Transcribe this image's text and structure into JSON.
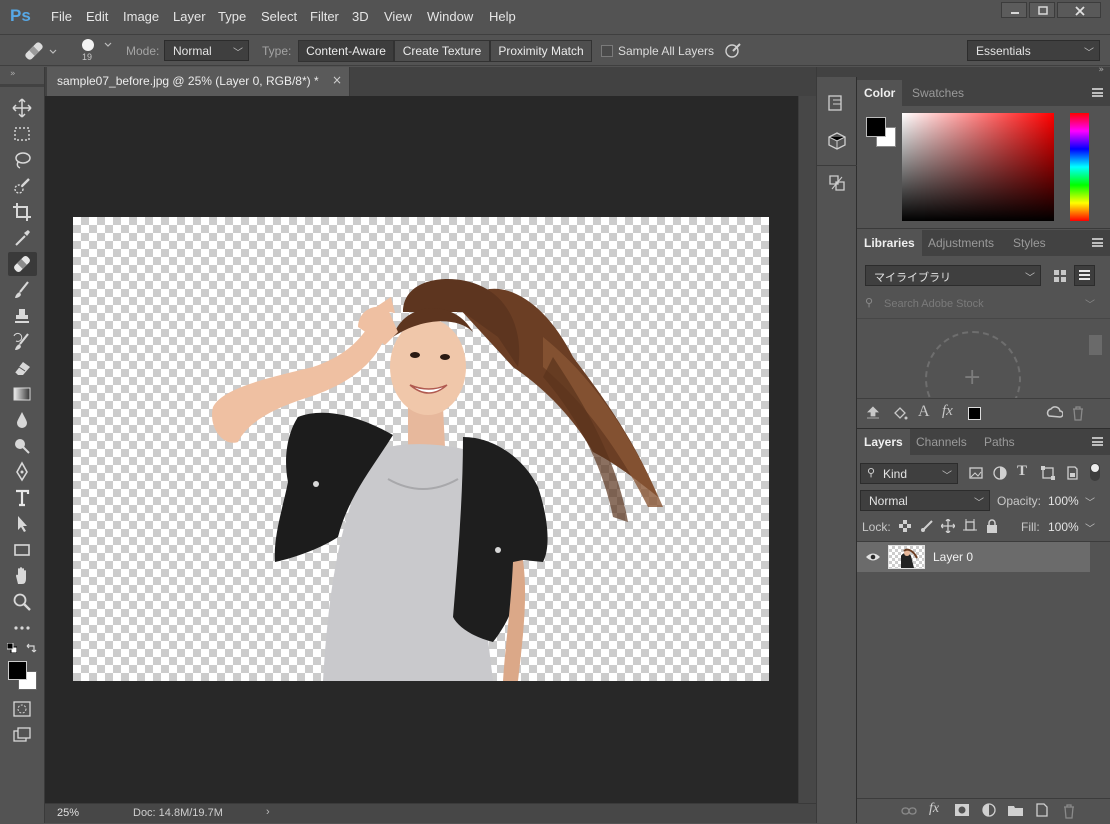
{
  "app": {
    "logo": "Ps"
  },
  "menu": [
    "File",
    "Edit",
    "Image",
    "Layer",
    "Type",
    "Select",
    "Filter",
    "3D",
    "View",
    "Window",
    "Help"
  ],
  "options": {
    "brush_size": "19",
    "mode_label": "Mode:",
    "mode_value": "Normal",
    "type_label": "Type:",
    "type_buttons": [
      "Content-Aware",
      "Create Texture",
      "Proximity Match"
    ],
    "sample_all_layers": "Sample All Layers",
    "sample_all_layers_checked": false,
    "workspace": "Essentials"
  },
  "document": {
    "tab_title": "sample07_before.jpg @ 25% (Layer 0, RGB/8*) *",
    "zoom": "25%",
    "doc_info": "Doc: 14.8M/19.7M"
  },
  "tools": [
    "move-tool",
    "marquee-tool",
    "lasso-tool",
    "quick-selection-tool",
    "crop-tool",
    "eyedropper-tool",
    "spot-healing-brush-tool",
    "brush-tool",
    "clone-stamp-tool",
    "history-brush-tool",
    "eraser-tool",
    "gradient-tool",
    "blur-tool",
    "dodge-tool",
    "pen-tool",
    "type-tool",
    "path-selection-tool",
    "rectangle-tool",
    "hand-tool",
    "zoom-tool",
    "more-tools"
  ],
  "colors": {
    "foreground": "#000000",
    "background": "#ffffff",
    "accent": "#57a8e6"
  },
  "color_panel": {
    "tabs": [
      "Color",
      "Swatches"
    ],
    "active": "Color"
  },
  "libraries_panel": {
    "tabs": [
      "Libraries",
      "Adjustments",
      "Styles"
    ],
    "active": "Libraries",
    "library": "マイライブラリ",
    "search_placeholder": "Search Adobe Stock"
  },
  "layers_panel": {
    "tabs": [
      "Layers",
      "Channels",
      "Paths"
    ],
    "active": "Layers",
    "filter_kind": "Kind",
    "blend_mode": "Normal",
    "opacity_label": "Opacity:",
    "opacity": "100%",
    "lock_label": "Lock:",
    "fill_label": "Fill:",
    "fill": "100%",
    "layers": [
      {
        "name": "Layer 0",
        "visible": true,
        "selected": true
      }
    ]
  }
}
